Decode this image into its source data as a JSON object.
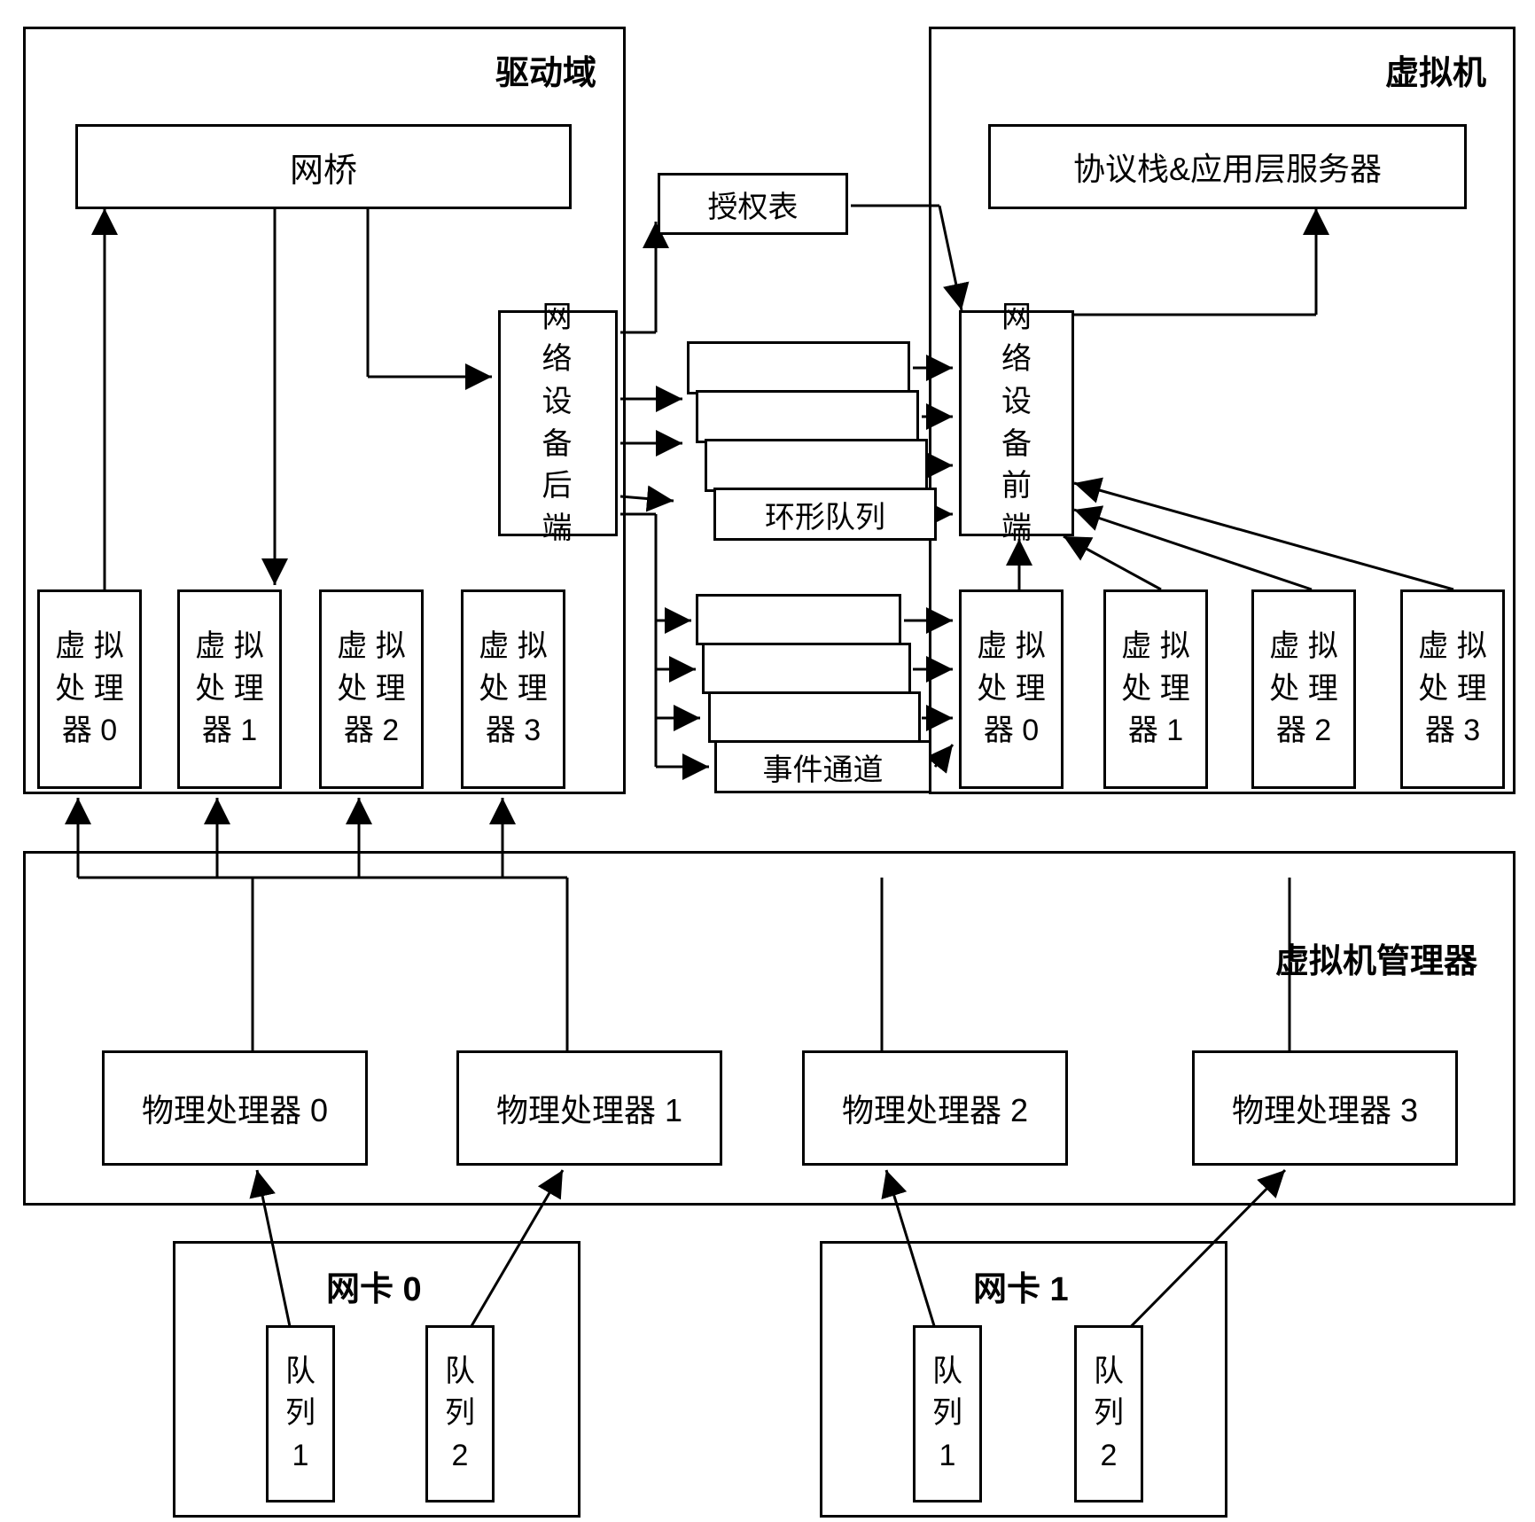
{
  "containers": {
    "driver_domain": "驱动域",
    "vm": "虚拟机",
    "vm_manager": "虚拟机管理器",
    "nic0": "网卡 0",
    "nic1": "网卡 1"
  },
  "driver": {
    "bridge": "网桥",
    "backend": [
      "网",
      "络",
      "设",
      "备",
      "后",
      "端"
    ],
    "vcpu0": [
      "虚 拟",
      "处 理",
      "器 0"
    ],
    "vcpu1": [
      "虚 拟",
      "处 理",
      "器 1"
    ],
    "vcpu2": [
      "虚 拟",
      "处 理",
      "器 2"
    ],
    "vcpu3": [
      "虚 拟",
      "处 理",
      "器 3"
    ]
  },
  "vm_box": {
    "protocol": "协议栈&应用层服务器",
    "frontend": [
      "网",
      "络",
      "设",
      "备",
      "前",
      "端"
    ],
    "vcpu0": [
      "虚 拟",
      "处 理",
      "器 0"
    ],
    "vcpu1": [
      "虚 拟",
      "处 理",
      "器 1"
    ],
    "vcpu2": [
      "虚 拟",
      "处 理",
      "器 2"
    ],
    "vcpu3": [
      "虚 拟",
      "处 理",
      "器 3"
    ]
  },
  "middle": {
    "grant_table": "授权表",
    "ring_queue": "环形队列",
    "event_channel": "事件通道"
  },
  "manager": {
    "pcpu0": "物理处理器 0",
    "pcpu1": "物理处理器 1",
    "pcpu2": "物理处理器 2",
    "pcpu3": "物理处理器 3"
  },
  "nic": {
    "q1": [
      "队",
      "列",
      "1"
    ],
    "q2": [
      "队",
      "列",
      "2"
    ]
  }
}
